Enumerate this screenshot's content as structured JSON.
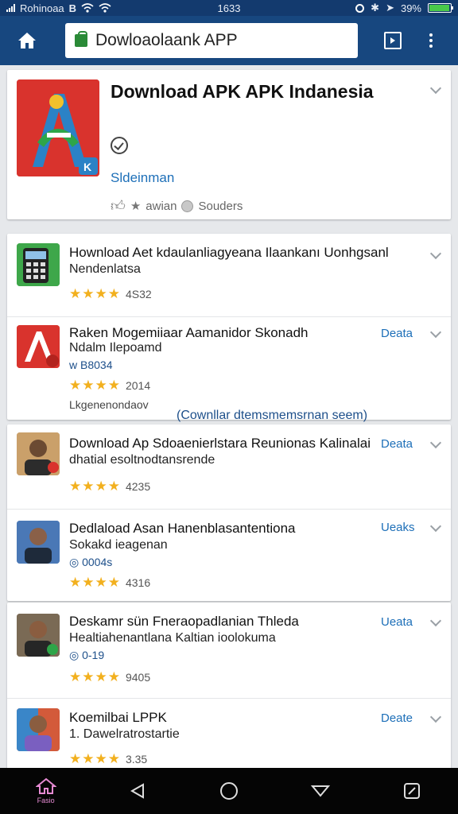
{
  "status_bar": {
    "carrier": "Rohinoaa",
    "time": "1633",
    "battery": "39%"
  },
  "app_bar": {
    "url": "Dowloaolaank APP"
  },
  "featured": {
    "title": "Download APK APK Indanesia",
    "developer": "Sldeinman",
    "meta_left": "awian",
    "meta_right": "Souders"
  },
  "list_group_1": [
    {
      "title": "Hownload Aet kdaulanliagyeana Ilaankanı Uonhgsanl",
      "subtitle": "Nendenlatsa",
      "rating": "4S32"
    },
    {
      "title": "Raken Mogemiiaar Aamanidor Skonadh",
      "subtitle": "Ndalm Ilepoamd",
      "extra": "w B8034",
      "rating": "2014",
      "note": "Lkgenenondaov",
      "action": "Deata"
    }
  ],
  "banner_link": "(Cownllar dtemsmemsrnan seem)",
  "list_group_2": [
    {
      "title": "Download Ap Sdoaenierlstara Reunionas Kalinalai",
      "subtitle": "dhatial esoltnodtansrende",
      "rating": "4235",
      "action": "Deata"
    },
    {
      "title": "Dedlaload Asan Hanenblasantentiona",
      "subtitle": "Sokakd ieagenan",
      "extra": "0004s",
      "rating": "4316",
      "action": "Ueaks"
    }
  ],
  "list_group_3": [
    {
      "title": "Deskamr sün Fneraopadlanian Thleda",
      "subtitle": "Healtiahenantlana Kaltian ioolokuma",
      "extra": "0-19",
      "rating": "9405",
      "action": "Ueata"
    },
    {
      "title": "Koemilbai LPPK",
      "subtitle": "1. Dawelratrostartie",
      "rating": "3.35",
      "action": "Deate"
    }
  ],
  "bottom_nav": {
    "home_label": "Fasio"
  },
  "colors": {
    "appbar": "#17477f",
    "status_bar": "#133a6e",
    "link": "#1d6fb8",
    "star": "#f2b01e"
  }
}
